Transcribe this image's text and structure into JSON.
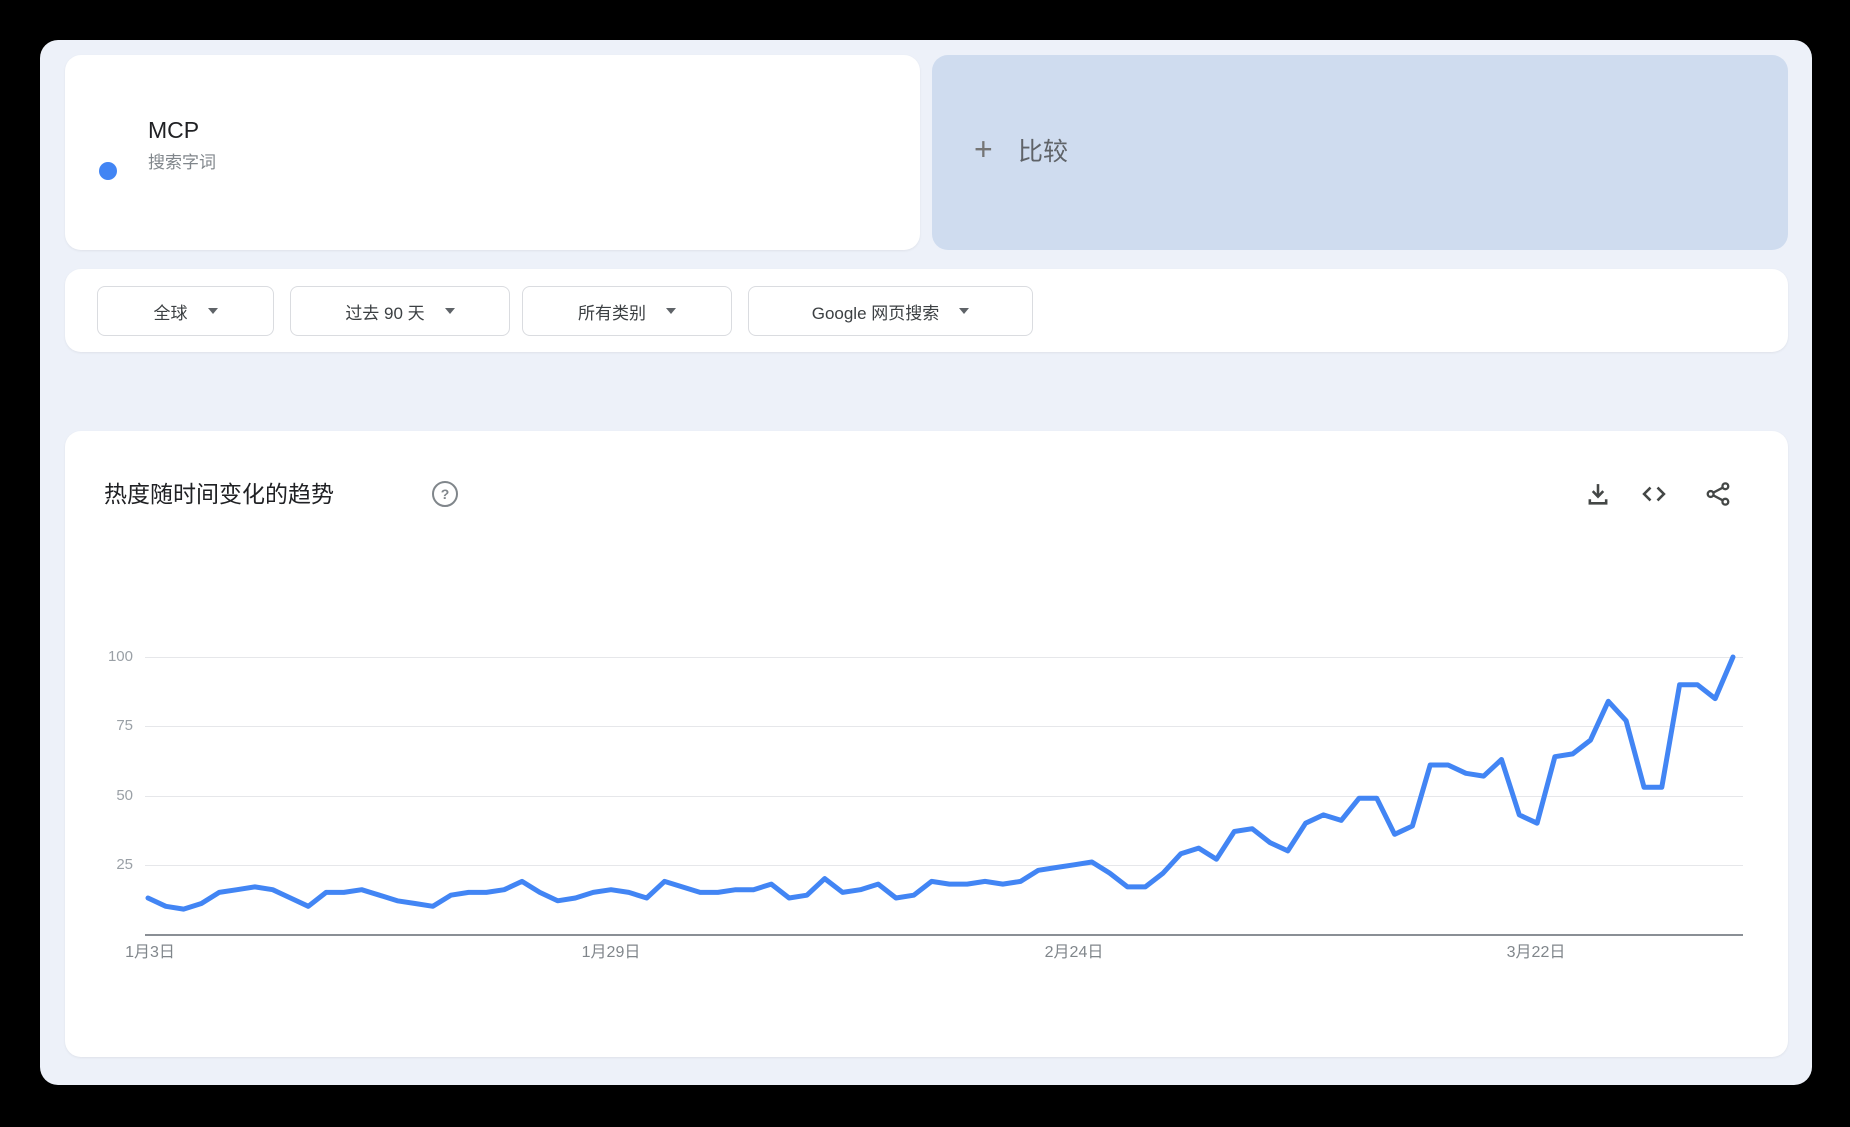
{
  "term_card": {
    "term": "MCP",
    "type_label": "搜索字词",
    "dot_color": "#4285f4"
  },
  "compare_card": {
    "plus_glyph": "+",
    "label": "比较"
  },
  "filters": [
    {
      "label": "全球"
    },
    {
      "label": "过去 90 天"
    },
    {
      "label": "所有类别"
    },
    {
      "label": "Google 网页搜索"
    }
  ],
  "chart_card": {
    "title": "热度随时间变化的趋势",
    "help_glyph": "?",
    "actions": [
      {
        "name": "download-icon"
      },
      {
        "name": "embed-code-icon"
      },
      {
        "name": "share-icon"
      }
    ]
  },
  "chart_data": {
    "type": "line",
    "title": "热度随时间变化的趋势",
    "xlabel": "",
    "ylabel": "",
    "ylim": [
      0,
      100
    ],
    "grid": true,
    "legend_position": "none",
    "y_ticks": [
      25,
      50,
      75,
      100
    ],
    "x_tick_labels": [
      "1月3日",
      "1月29日",
      "2月24日",
      "3月22日"
    ],
    "x_tick_indices": [
      0,
      26,
      52,
      78
    ],
    "num_points": 90,
    "series": [
      {
        "name": "MCP",
        "color": "#4285f4",
        "values": [
          13,
          10,
          9,
          11,
          15,
          16,
          17,
          16,
          13,
          10,
          15,
          15,
          16,
          14,
          12,
          11,
          10,
          14,
          15,
          15,
          16,
          19,
          15,
          12,
          13,
          15,
          16,
          15,
          13,
          19,
          17,
          15,
          15,
          16,
          16,
          18,
          13,
          14,
          20,
          15,
          16,
          18,
          13,
          14,
          19,
          18,
          18,
          19,
          18,
          19,
          23,
          24,
          25,
          26,
          22,
          17,
          17,
          22,
          29,
          31,
          27,
          37,
          38,
          33,
          30,
          40,
          43,
          41,
          49,
          49,
          36,
          39,
          61,
          61,
          58,
          57,
          63,
          43,
          40,
          64,
          65,
          70,
          84,
          77,
          53,
          53,
          90,
          90,
          85,
          100
        ]
      }
    ]
  }
}
